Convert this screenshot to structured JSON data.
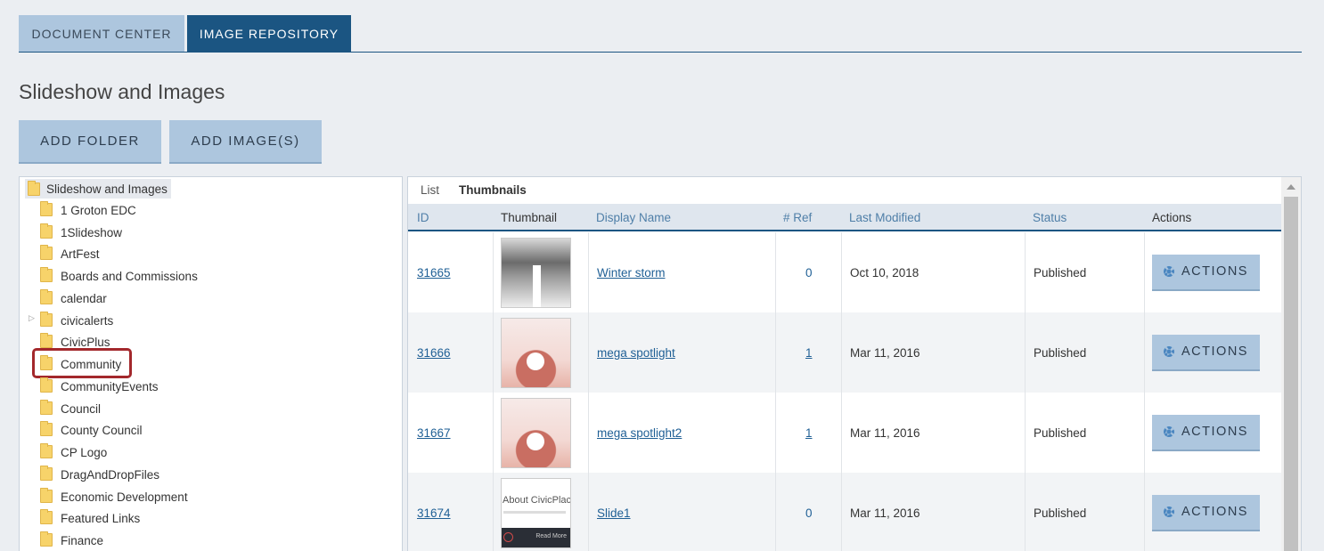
{
  "tabs": [
    {
      "label": "DOCUMENT CENTER"
    },
    {
      "label": "IMAGE REPOSITORY"
    }
  ],
  "page_title": "Slideshow and Images",
  "buttons": {
    "add_folder": "ADD FOLDER",
    "add_images": "ADD IMAGE(S)"
  },
  "tree": {
    "root": "Slideshow and Images",
    "items": [
      {
        "label": "1 Groton EDC"
      },
      {
        "label": "1Slideshow"
      },
      {
        "label": "ArtFest"
      },
      {
        "label": "Boards and Commissions"
      },
      {
        "label": "calendar"
      },
      {
        "label": "civicalerts"
      },
      {
        "label": "CivicPlus"
      },
      {
        "label": "Community"
      },
      {
        "label": "CommunityEvents"
      },
      {
        "label": "Council"
      },
      {
        "label": "County Council"
      },
      {
        "label": "CP Logo"
      },
      {
        "label": "DragAndDropFiles"
      },
      {
        "label": "Economic Development"
      },
      {
        "label": "Featured Links"
      },
      {
        "label": "Finance"
      }
    ]
  },
  "view_toggle": {
    "list": "List",
    "thumbnails": "Thumbnails"
  },
  "table": {
    "headers": {
      "id": "ID",
      "thumbnail": "Thumbnail",
      "display_name": "Display Name",
      "ref": "# Ref",
      "last_modified": "Last Modified",
      "status": "Status",
      "actions": "Actions"
    },
    "rows": [
      {
        "id": "31665",
        "name": "Winter storm",
        "ref": "0",
        "modified": "Oct 10, 2018",
        "status": "Published",
        "action": "ACTIONS",
        "thumb": "winter-storm-thumbnail"
      },
      {
        "id": "31666",
        "name": "mega spotlight",
        "ref": "1",
        "modified": "Mar 11, 2016",
        "status": "Published",
        "action": "ACTIONS",
        "thumb": "mega-spotlight-thumbnail"
      },
      {
        "id": "31667",
        "name": "mega spotlight2",
        "ref": "1",
        "modified": "Mar 11, 2016",
        "status": "Published",
        "action": "ACTIONS",
        "thumb": "mega-spotlight-thumbnail"
      },
      {
        "id": "31674",
        "name": "Slide1",
        "ref": "0",
        "modified": "Mar 11, 2016",
        "status": "Published",
        "action": "ACTIONS",
        "thumb": "slide-thumbnail"
      }
    ],
    "slide_thumb_title": "About CivicPlac",
    "slide_thumb_button": "Read More"
  },
  "colors": {
    "accent": "#1b5582",
    "button": "#adc6de",
    "highlight": "#a3282c",
    "link": "#1f5f95"
  }
}
